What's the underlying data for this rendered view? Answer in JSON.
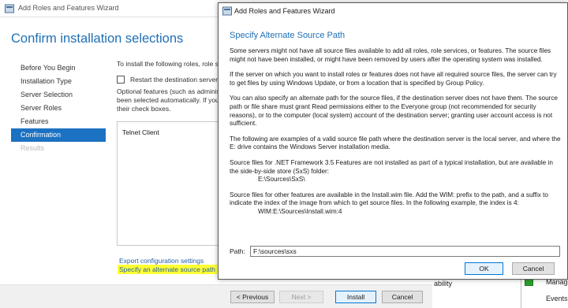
{
  "background_wizard": {
    "title": "Add Roles and Features Wizard",
    "heading": "Confirm installation selections",
    "nav": [
      {
        "label": "Before You Begin",
        "state": "normal"
      },
      {
        "label": "Installation Type",
        "state": "normal"
      },
      {
        "label": "Server Selection",
        "state": "normal"
      },
      {
        "label": "Server Roles",
        "state": "normal"
      },
      {
        "label": "Features",
        "state": "normal"
      },
      {
        "label": "Confirmation",
        "state": "active"
      },
      {
        "label": "Results",
        "state": "disabled"
      }
    ],
    "intro": "To install the following roles, role s",
    "restart_label": "Restart the destination server",
    "optional_lines": [
      "Optional features (such as adminis",
      "been selected automatically. If you",
      "their check boxes."
    ],
    "list_items": [
      "Telnet Client"
    ],
    "export_link": "Export configuration settings",
    "alternate_source_link": "Specify an alternate source path",
    "buttons": {
      "previous": "< Previous",
      "next": "Next >",
      "install": "Install",
      "cancel": "Cancel"
    }
  },
  "server_manager_peek": {
    "label": "ability",
    "manage": "Manage",
    "events": "Events"
  },
  "dialog": {
    "title": "Add Roles and Features Wizard",
    "heading": "Specify Alternate Source Path",
    "paragraphs": [
      "Some servers might not have all source files available to add all roles, role services, or features. The source files might not have been installed, or might have been removed by users after the operating system was installed.",
      "If the server on which you want to install roles or features does not have all required source files, the server can try to get files by using Windows Update, or from a location that is specified by Group Policy.",
      "You can also specify an alternate path for the source files, if the destination server does not have them. The source path or file share must grant Read permissions either to the Everyone group (not recommended for security reasons), or to the computer (local system) account of the destination server; granting user account access is not sufficient.",
      "The following are examples of a valid source file path where the destination server is the local server, and where the E: drive contains the Windows Server installation media."
    ],
    "example1_text": "Source files for .NET Framework 3.5 Features are not installed as part of a typical installation, but are available in the side-by-side store (SxS) folder:",
    "example1_path": "E:\\Sources\\SxS\\",
    "example2_text": "Source files for other features are available in the Install.wim file. Add the WIM: prefix to the path, and a suffix to indicate the index of the image from which to get source files. In the following example, the index is 4:",
    "example2_path": "WIM:E:\\Sources\\Install.wim:4",
    "path_label": "Path:",
    "path_value": "F:\\sources\\sxs",
    "ok_label": "OK",
    "cancel_label": "Cancel"
  },
  "colors": {
    "accent_blue": "#1c72c2",
    "heading_blue": "#1f6fb6",
    "link_blue": "#1f5fa8",
    "highlight_yellow": "#ffff33"
  }
}
